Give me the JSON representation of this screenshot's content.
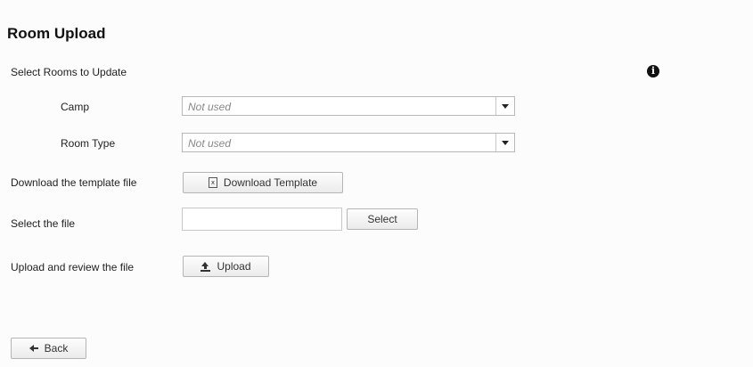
{
  "page": {
    "title": "Room Upload"
  },
  "form": {
    "select_rooms_label": "Select Rooms to Update",
    "camp_label": "Camp",
    "camp_value": "Not used",
    "room_type_label": "Room Type",
    "room_type_value": "Not used",
    "download_label": "Download the template file",
    "download_button": "Download Template",
    "select_file_label": "Select the file",
    "file_value": "",
    "select_button": "Select",
    "upload_label": "Upload and review the file",
    "upload_button": "Upload"
  },
  "footer": {
    "back_button": "Back"
  },
  "icons": {
    "info": "info-icon",
    "dropdown": "chevron-down-icon",
    "excel": "excel-file-icon",
    "upload": "upload-icon",
    "back": "arrow-left-icon"
  },
  "icon_glyphs": {
    "info": "i",
    "excel": "x"
  }
}
